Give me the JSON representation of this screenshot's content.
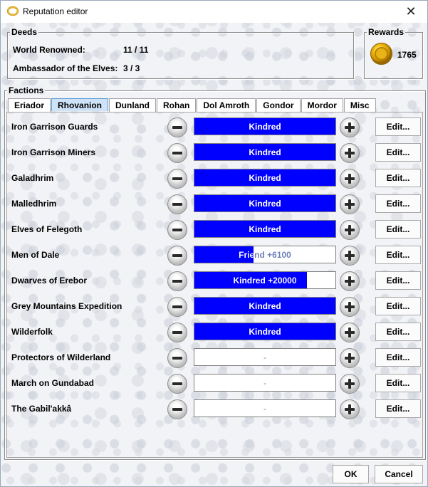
{
  "window": {
    "title": "Reputation editor",
    "close_glyph": "✕"
  },
  "deeds": {
    "label": "Deeds",
    "items": [
      {
        "name": "World Renowned:",
        "value": "11 / 11"
      },
      {
        "name": "Ambassador of the Elves:",
        "value": "3 / 3"
      }
    ]
  },
  "rewards": {
    "label": "Rewards",
    "icon": "gold-coin-icon",
    "amount": "1765"
  },
  "factions": {
    "label": "Factions",
    "tabs": [
      {
        "label": "Eriador",
        "active": false
      },
      {
        "label": "Rhovanion",
        "active": true
      },
      {
        "label": "Dunland",
        "active": false
      },
      {
        "label": "Rohan",
        "active": false
      },
      {
        "label": "Dol Amroth",
        "active": false
      },
      {
        "label": "Gondor",
        "active": false
      },
      {
        "label": "Mordor",
        "active": false
      },
      {
        "label": "Misc",
        "active": false
      }
    ],
    "edit_label": "Edit...",
    "rows": [
      {
        "name": "Iron Garrison Guards",
        "standing": "Kindred",
        "progress": 1.0
      },
      {
        "name": "Iron Garrison Miners",
        "standing": "Kindred",
        "progress": 1.0
      },
      {
        "name": "Galadhrim",
        "standing": "Kindred",
        "progress": 1.0
      },
      {
        "name": "Malledhrim",
        "standing": "Kindred",
        "progress": 1.0
      },
      {
        "name": "Elves of Felegoth",
        "standing": "Kindred",
        "progress": 1.0
      },
      {
        "name": "Men of Dale",
        "standing": "Friend +6100",
        "progress": 0.42
      },
      {
        "name": "Dwarves of Erebor",
        "standing": "Kindred +20000",
        "progress": 0.8
      },
      {
        "name": "Grey Mountains Expedition",
        "standing": "Kindred",
        "progress": 1.0
      },
      {
        "name": "Wilderfolk",
        "standing": "Kindred",
        "progress": 1.0
      },
      {
        "name": "Protectors of Wilderland",
        "standing": "-",
        "progress": 0
      },
      {
        "name": "March on Gundabad",
        "standing": "-",
        "progress": 0
      },
      {
        "name": "The Gabil'akkâ",
        "standing": "-",
        "progress": 0
      }
    ]
  },
  "footer": {
    "ok_label": "OK",
    "cancel_label": "Cancel"
  },
  "colors": {
    "bar_fill": "#0000ff",
    "active_tab": "#cfe3f8"
  }
}
